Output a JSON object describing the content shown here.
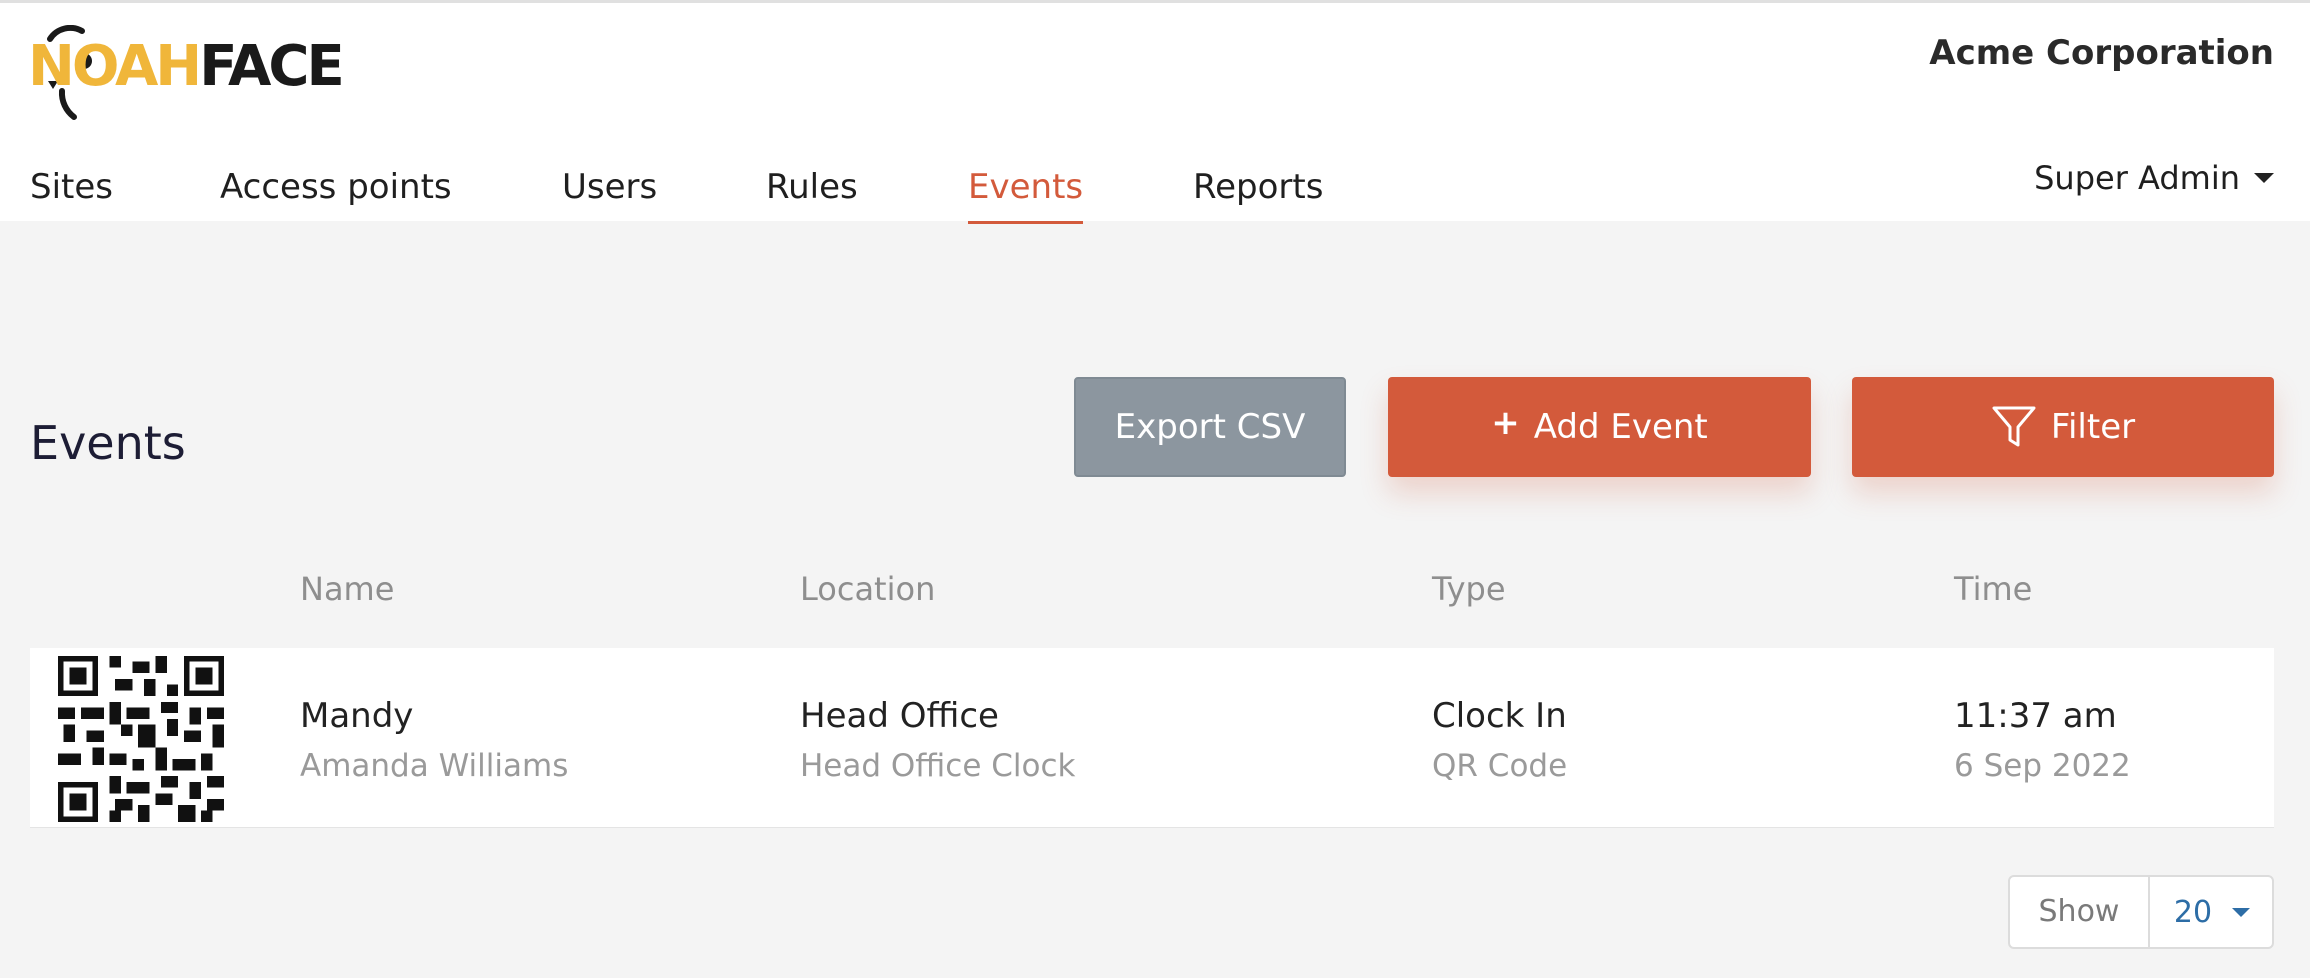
{
  "app": {
    "logo_text_yellow": "NOAH",
    "logo_text_black": "FACE",
    "company": "Acme Corporation"
  },
  "nav": {
    "items": [
      {
        "label": "Sites"
      },
      {
        "label": "Access points"
      },
      {
        "label": "Users"
      },
      {
        "label": "Rules"
      },
      {
        "label": "Events",
        "active": true
      },
      {
        "label": "Reports"
      }
    ],
    "user_menu": "Super Admin"
  },
  "page": {
    "title": "Events"
  },
  "toolbar": {
    "export_label": "Export CSV",
    "add_label": "Add Event",
    "filter_label": "Filter",
    "plus_icon": "+"
  },
  "table": {
    "headers": [
      "Name",
      "Location",
      "Type",
      "Time"
    ],
    "rows": [
      {
        "name": "Mandy",
        "full_name": "Amanda Williams",
        "location": "Head Office",
        "access_point": "Head Office Clock",
        "type": "Clock In",
        "method": "QR Code",
        "time": "11:37 am",
        "date": "6 Sep 2022",
        "icon": "qr-code-icon"
      }
    ]
  },
  "pagination": {
    "show_label": "Show",
    "page_size": "20"
  },
  "colors": {
    "accent": "#d35a3b",
    "logo_yellow": "#f0b63a",
    "export_gray": "#8c969f",
    "link_blue": "#2d6da6"
  }
}
